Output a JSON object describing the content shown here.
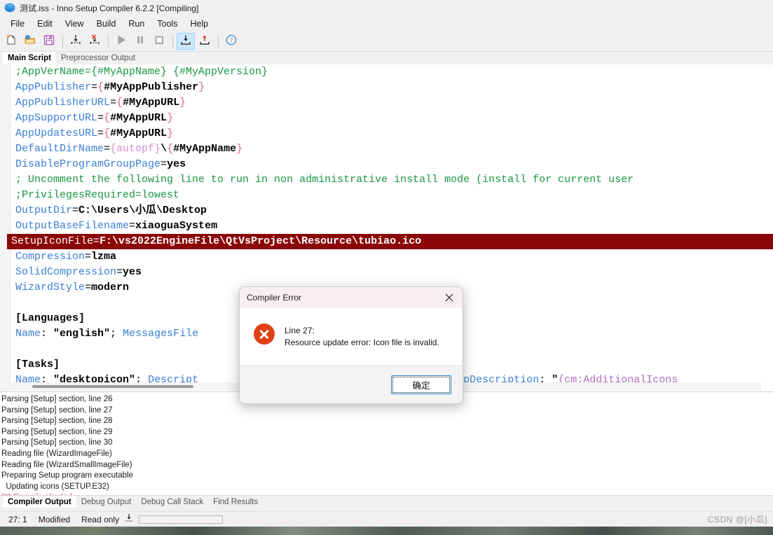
{
  "window": {
    "title": "测试.iss - Inno Setup Compiler 6.2.2  [Compiling]",
    "app_icon": "inno-setup-icon"
  },
  "menubar": {
    "items": [
      "File",
      "Edit",
      "View",
      "Build",
      "Run",
      "Tools",
      "Help"
    ]
  },
  "toolbar": {
    "buttons": [
      {
        "name": "new-file",
        "icon": "new-file-icon"
      },
      {
        "name": "open-file",
        "icon": "open-folder-icon"
      },
      {
        "name": "save-file",
        "icon": "floppy-save-icon"
      },
      {
        "name": "compile",
        "icon": "compile-down-icon"
      },
      {
        "name": "stop-compile",
        "icon": "stop-compile-icon"
      },
      {
        "name": "run",
        "icon": "play-icon"
      },
      {
        "name": "pause",
        "icon": "pause-icon"
      },
      {
        "name": "stop",
        "icon": "stop-square-icon"
      },
      {
        "name": "step-into",
        "icon": "step-into-icon"
      },
      {
        "name": "step-out",
        "icon": "step-out-icon"
      },
      {
        "name": "help",
        "icon": "question-circle-icon"
      }
    ]
  },
  "editor_tabs": [
    {
      "label": "Main Script",
      "selected": true
    },
    {
      "label": "Preprocessor Output",
      "selected": false
    }
  ],
  "code_lines": [
    {
      "id": 1,
      "error": false,
      "tokens": [
        {
          "c": "cm",
          "t": ";AppVerName={#MyAppName} {#MyAppVersion}"
        }
      ]
    },
    {
      "id": 2,
      "error": false,
      "tokens": [
        {
          "c": "k",
          "t": "AppPublisher"
        },
        {
          "c": "t",
          "t": "="
        },
        {
          "c": "br",
          "t": "{"
        },
        {
          "c": "v",
          "t": "#MyAppPublisher"
        },
        {
          "c": "br",
          "t": "}"
        }
      ]
    },
    {
      "id": 3,
      "error": false,
      "tokens": [
        {
          "c": "k",
          "t": "AppPublisherURL"
        },
        {
          "c": "t",
          "t": "="
        },
        {
          "c": "br",
          "t": "{"
        },
        {
          "c": "v",
          "t": "#MyAppURL"
        },
        {
          "c": "br",
          "t": "}"
        }
      ]
    },
    {
      "id": 4,
      "error": false,
      "tokens": [
        {
          "c": "k",
          "t": "AppSupportURL"
        },
        {
          "c": "t",
          "t": "="
        },
        {
          "c": "br",
          "t": "{"
        },
        {
          "c": "v",
          "t": "#MyAppURL"
        },
        {
          "c": "br",
          "t": "}"
        }
      ]
    },
    {
      "id": 5,
      "error": false,
      "tokens": [
        {
          "c": "k",
          "t": "AppUpdatesURL"
        },
        {
          "c": "t",
          "t": "="
        },
        {
          "c": "br",
          "t": "{"
        },
        {
          "c": "v",
          "t": "#MyAppURL"
        },
        {
          "c": "br",
          "t": "}"
        }
      ]
    },
    {
      "id": 6,
      "error": false,
      "tokens": [
        {
          "c": "k",
          "t": "DefaultDirName"
        },
        {
          "c": "t",
          "t": "="
        },
        {
          "c": "cn",
          "t": "{autopf}"
        },
        {
          "c": "v",
          "t": "\\"
        },
        {
          "c": "br",
          "t": "{"
        },
        {
          "c": "v",
          "t": "#MyAppName"
        },
        {
          "c": "br",
          "t": "}"
        }
      ]
    },
    {
      "id": 7,
      "error": false,
      "tokens": [
        {
          "c": "k",
          "t": "DisableProgramGroupPage"
        },
        {
          "c": "t",
          "t": "="
        },
        {
          "c": "v",
          "t": "yes"
        }
      ]
    },
    {
      "id": 8,
      "error": false,
      "tokens": [
        {
          "c": "cm",
          "t": "; Uncomment the following line to run in non administrative install mode (install for current user"
        }
      ]
    },
    {
      "id": 9,
      "error": false,
      "tokens": [
        {
          "c": "cm",
          "t": ";PrivilegesRequired=lowest"
        }
      ]
    },
    {
      "id": 10,
      "error": false,
      "tokens": [
        {
          "c": "k",
          "t": "OutputDir"
        },
        {
          "c": "t",
          "t": "="
        },
        {
          "c": "v",
          "t": "C:\\Users\\小瓜\\Desktop"
        }
      ]
    },
    {
      "id": 11,
      "error": false,
      "tokens": [
        {
          "c": "k",
          "t": "OutputBaseFilename"
        },
        {
          "c": "t",
          "t": "="
        },
        {
          "c": "v",
          "t": "xiaoguaSystem"
        }
      ]
    },
    {
      "id": 12,
      "error": true,
      "tokens": [
        {
          "c": "k",
          "t": "SetupIconFile"
        },
        {
          "c": "t",
          "t": "="
        },
        {
          "c": "v",
          "t": "F:\\vs2022EngineFile\\QtVsProject\\Resource\\tubiao.ico"
        }
      ]
    },
    {
      "id": 13,
      "error": false,
      "tokens": [
        {
          "c": "k",
          "t": "Compression"
        },
        {
          "c": "t",
          "t": "="
        },
        {
          "c": "v",
          "t": "lzma"
        }
      ]
    },
    {
      "id": 14,
      "error": false,
      "tokens": [
        {
          "c": "k",
          "t": "SolidCompression"
        },
        {
          "c": "t",
          "t": "="
        },
        {
          "c": "v",
          "t": "yes"
        }
      ]
    },
    {
      "id": 15,
      "error": false,
      "tokens": [
        {
          "c": "k",
          "t": "WizardStyle"
        },
        {
          "c": "t",
          "t": "="
        },
        {
          "c": "v",
          "t": "modern"
        }
      ]
    },
    {
      "id": 16,
      "error": false,
      "tokens": [
        {
          "c": "t",
          "t": ""
        }
      ]
    },
    {
      "id": 17,
      "error": false,
      "tokens": [
        {
          "c": "sec",
          "t": "[Languages]"
        }
      ]
    },
    {
      "id": 18,
      "error": false,
      "tokens": [
        {
          "c": "k",
          "t": "Name"
        },
        {
          "c": "t",
          "t": ": "
        },
        {
          "c": "str",
          "t": "\"english\""
        },
        {
          "c": "t",
          "t": "; "
        },
        {
          "c": "k",
          "t": "MessagesFile"
        }
      ]
    },
    {
      "id": 19,
      "error": false,
      "tokens": [
        {
          "c": "t",
          "t": ""
        }
      ]
    },
    {
      "id": 20,
      "error": false,
      "tokens": [
        {
          "c": "sec",
          "t": "[Tasks]"
        }
      ]
    },
    {
      "id": 21,
      "error": false,
      "tokens": [
        {
          "c": "k",
          "t": "Name"
        },
        {
          "c": "t",
          "t": ": "
        },
        {
          "c": "str",
          "t": "\"desktopicon\""
        },
        {
          "c": "t",
          "t": "; "
        },
        {
          "c": "k",
          "t": "Descript"
        }
      ]
    }
  ],
  "code_overlay_right": {
    "line18_tail": "",
    "line21_tail": "; ",
    "line21_key": "GroupDescription",
    "line21_colon": ": ",
    "line21_quote": "\"",
    "line21_cm": "{cm:AdditionalIcons"
  },
  "dialog": {
    "title": "Compiler Error",
    "close_icon": "close-x-icon",
    "error_icon": "error-circle-x-icon",
    "line_label": "Line 27:",
    "message": "Resource update error: Icon file is invalid.",
    "ok_label": "确定"
  },
  "output_log": [
    {
      "text": "Parsing [Setup] section, line 26",
      "abort": false
    },
    {
      "text": "Parsing [Setup] section, line 27",
      "abort": false
    },
    {
      "text": "Parsing [Setup] section, line 28",
      "abort": false
    },
    {
      "text": "Parsing [Setup] section, line 29",
      "abort": false
    },
    {
      "text": "Parsing [Setup] section, line 30",
      "abort": false
    },
    {
      "text": "Reading file (WizardImageFile)",
      "abort": false
    },
    {
      "text": "Reading file (WizardSmallImageFile)",
      "abort": false
    },
    {
      "text": "Preparing Setup program executable",
      "abort": false
    },
    {
      "text": "  Updating icons (SETUP.E32)",
      "abort": false
    },
    {
      "text": "*** Compile aborted.",
      "abort": true
    }
  ],
  "bottom_tabs": [
    {
      "label": "Compiler Output",
      "selected": true
    },
    {
      "label": "Debug Output",
      "selected": false
    },
    {
      "label": "Debug Call Stack",
      "selected": false
    },
    {
      "label": "Find Results",
      "selected": false
    }
  ],
  "statusbar": {
    "position": "27:  1",
    "modified": "Modified",
    "readonly": "Read only",
    "icon": "insert-mode-icon",
    "progress_value": 0,
    "watermark": "CSDN @[小瓜]"
  },
  "colors": {
    "error_line_bg": "#8b0707",
    "comment_green": "#1a9641",
    "key_blue": "#3a7fd5",
    "macro_pink": "#e0648c",
    "constant_purple": "#cf8fd0",
    "error_icon": "#e04113",
    "abort_red": "#e8607f",
    "toolbar_active": "#cce8ff"
  }
}
